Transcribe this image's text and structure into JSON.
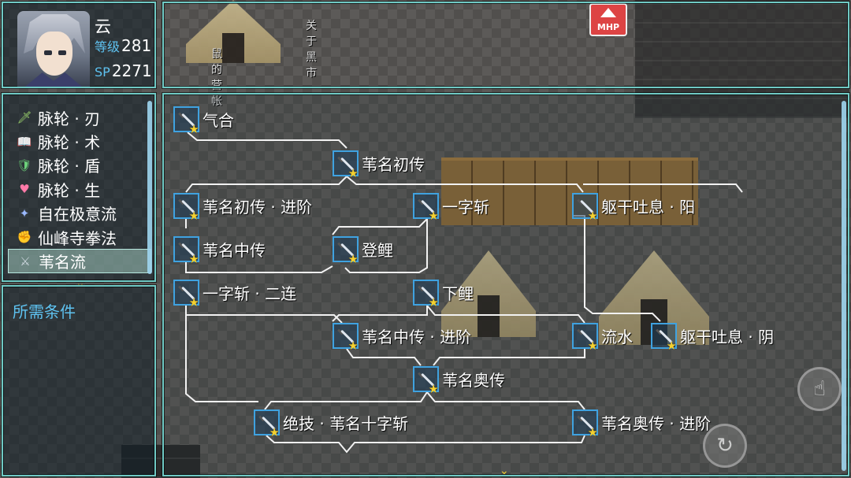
{
  "map": {
    "labels": [
      "关于黑市",
      "鼠的营帐"
    ],
    "sign": "MHP"
  },
  "status": {
    "name": "云",
    "level_label": "等级",
    "level": "281",
    "sp_label": "SP",
    "sp": "2271"
  },
  "skill_types": [
    {
      "label": "脉轮 · 刃",
      "icon": "blade-chakra-icon",
      "glyph": "🗡",
      "color": "#9ad16a"
    },
    {
      "label": "脉轮 · 术",
      "icon": "book-chakra-icon",
      "glyph": "📖",
      "color": "#d9a0ff"
    },
    {
      "label": "脉轮 · 盾",
      "icon": "shield-chakra-icon",
      "glyph": "🛡",
      "color": "#6cd17a"
    },
    {
      "label": "脉轮 · 生",
      "icon": "heart-chakra-icon",
      "glyph": "♥",
      "color": "#ff7aa8"
    },
    {
      "label": "自在极意流",
      "icon": "figure-icon",
      "glyph": "✦",
      "color": "#9ab8ff"
    },
    {
      "label": "仙峰寺拳法",
      "icon": "fist-icon",
      "glyph": "✊",
      "color": "#f2d680"
    },
    {
      "label": "苇名流",
      "icon": "sword-icon",
      "glyph": "⚔",
      "color": "#cfd8e0",
      "selected": true
    }
  ],
  "requirements": {
    "title": "所需条件"
  },
  "tree": {
    "nodes": [
      {
        "label": "气合"
      },
      {
        "label": "苇名初传"
      },
      {
        "label": "苇名初传 · 进阶"
      },
      {
        "label": "一字斩"
      },
      {
        "label": "躯干吐息 · 阳"
      },
      {
        "label": "苇名中传"
      },
      {
        "label": "登鲤"
      },
      {
        "label": "一字斩 · 二连"
      },
      {
        "label": "下鲤"
      },
      {
        "label": "苇名中传 · 进阶"
      },
      {
        "label": "流水"
      },
      {
        "label": "躯干吐息 · 阴"
      },
      {
        "label": "苇名奥传"
      },
      {
        "label": "绝技 · 苇名十字斩"
      },
      {
        "label": "苇名奥传 · 进阶"
      }
    ]
  },
  "buttons": {
    "touch": "touch-icon",
    "back": "return-icon"
  },
  "colors": {
    "window_border": "#6fc9c4",
    "accent_label": "#5ec2f0",
    "node_border": "#3fa2e0",
    "star": "#f4d030"
  }
}
